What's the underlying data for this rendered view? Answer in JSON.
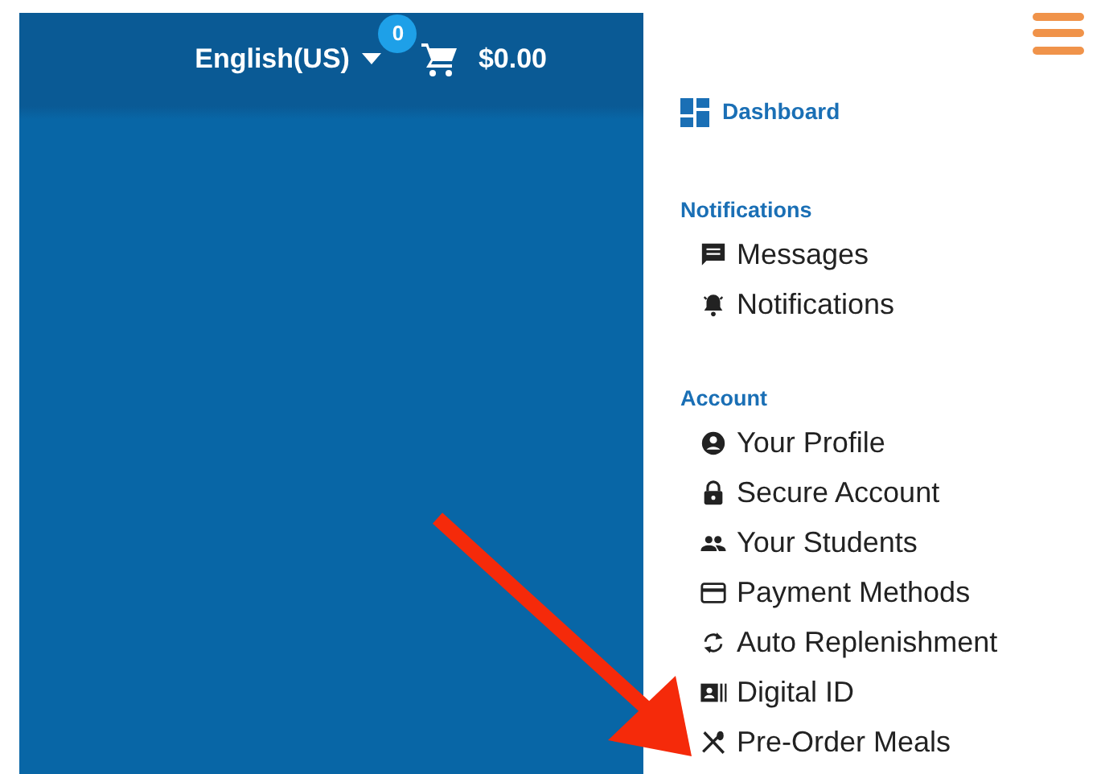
{
  "top_bar": {
    "language": "English(US)",
    "cart_count": "0",
    "cart_total": "$0.00"
  },
  "menu": {
    "dashboard": "Dashboard",
    "sections": [
      {
        "heading": "Notifications",
        "items": [
          {
            "label": "Messages",
            "kind": "message"
          },
          {
            "label": "Notifications",
            "kind": "bell"
          }
        ]
      },
      {
        "heading": "Account",
        "items": [
          {
            "label": "Your Profile",
            "kind": "profile"
          },
          {
            "label": "Secure Account",
            "kind": "lock"
          },
          {
            "label": "Your Students",
            "kind": "people"
          },
          {
            "label": "Payment Methods",
            "kind": "card"
          },
          {
            "label": "Auto Replenishment",
            "kind": "refresh"
          },
          {
            "label": "Digital ID",
            "kind": "id"
          },
          {
            "label": "Pre-Order Meals",
            "kind": "utensils"
          }
        ]
      }
    ]
  }
}
